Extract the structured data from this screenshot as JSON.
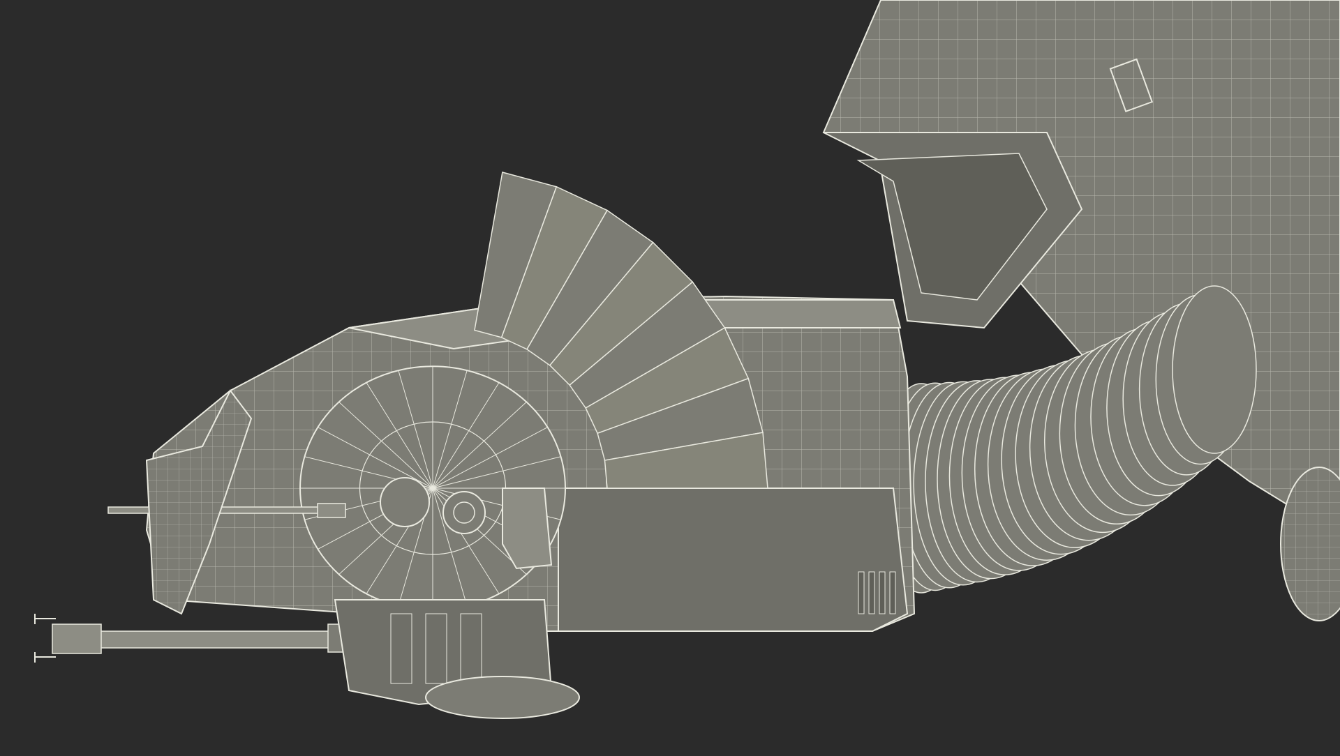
{
  "scene": {
    "description_label": "",
    "colors": {
      "background": "#2b2b2b",
      "surface": "#7c7c74",
      "surface_light": "#8d8d84",
      "surface_dark": "#5f5f58",
      "wire": "#e9e9df"
    }
  }
}
